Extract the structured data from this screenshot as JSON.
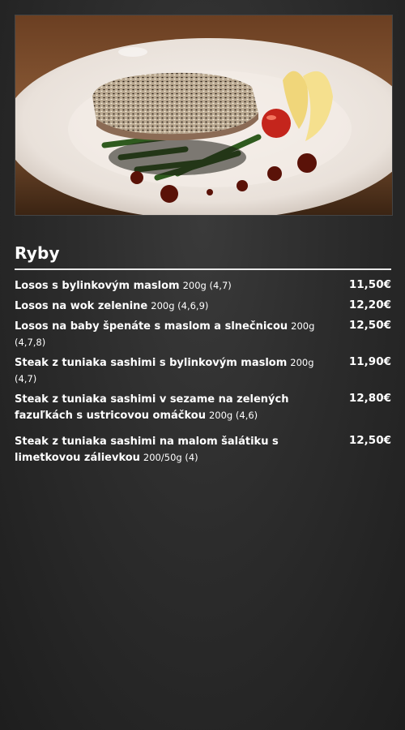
{
  "section": {
    "title": "Ryby"
  },
  "photo": {
    "alt": "seared sesame tuna steak with green beans, tomato and lemon"
  },
  "items": [
    {
      "name": "Losos s bylinkovým maslom",
      "detail": "200g (4,7)",
      "price": "11,50€"
    },
    {
      "name": "Losos na wok zelenine",
      "detail": "200g (4,6,9)",
      "price": "12,20€"
    },
    {
      "name": "Losos na baby špenáte s maslom a slnečnicou",
      "detail": "200g (4,7,8)",
      "price": "12,50€"
    },
    {
      "name": "Steak z tuniaka sashimi s bylinkovým maslom",
      "detail": "200g (4,7)",
      "price": "11,90€"
    },
    {
      "name": "Steak z tuniaka sashimi v sezame na zelených fazuľkách s ustricovou omáčkou",
      "detail": "200g (4,6)",
      "price": "12,80€"
    },
    {
      "name": "Steak z tuniaka sashimi na malom šalátiku s limetkovou zálievkou",
      "detail": "200/50g (4)",
      "price": "12,50€"
    }
  ]
}
